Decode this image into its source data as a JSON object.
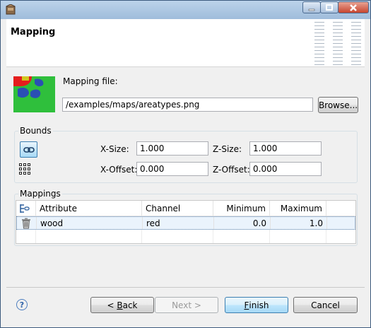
{
  "dialog": {
    "title": "Mapping"
  },
  "mapping_file": {
    "label": "Mapping file:",
    "path": "/examples/maps/areatypes.png",
    "browse_label": "Browse..."
  },
  "bounds": {
    "group_label": "Bounds",
    "x_size_label": "X-Size:",
    "x_size": "1.000",
    "z_size_label": "Z-Size:",
    "z_size": "1.000",
    "x_offset_label": "X-Offset:",
    "x_offset": "0.000",
    "z_offset_label": "Z-Offset:",
    "z_offset": "0.000"
  },
  "mappings": {
    "group_label": "Mappings",
    "columns": [
      "Attribute",
      "Channel",
      "Minimum",
      "Maximum"
    ],
    "rows": [
      {
        "attribute": "wood",
        "channel": "red",
        "minimum": "0.0",
        "maximum": "1.0"
      }
    ]
  },
  "footer": {
    "back_prefix": "< ",
    "back_key": "B",
    "back_rest": "ack",
    "next_label": "Next >",
    "finish_key": "F",
    "finish_rest": "inish",
    "cancel_label": "Cancel"
  },
  "colors": {
    "accent": "#3c7fb1",
    "preview_green": "#2fbf3c",
    "preview_red": "#e51d1d",
    "preview_blue": "#2a4fb4"
  }
}
